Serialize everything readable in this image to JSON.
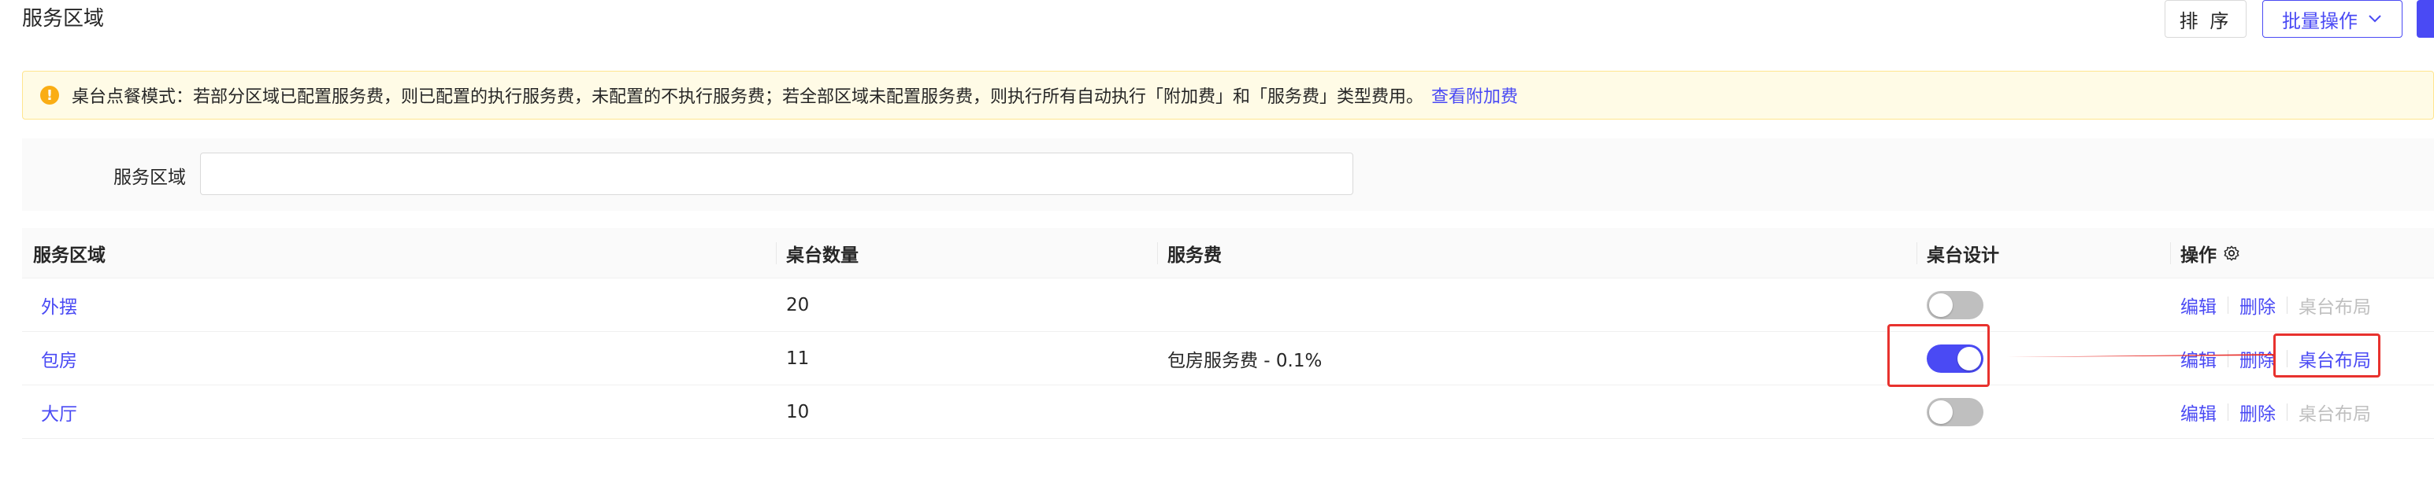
{
  "header": {
    "title": "服务区域",
    "sort_label": "排 序",
    "batch_label": "批量操作"
  },
  "notice": {
    "text": "桌台点餐模式：若部分区域已配置服务费，则已配置的执行服务费，未配置的不执行服务费；若全部区域未配置服务费，则执行所有自动执行「附加费」和「服务费」类型费用。",
    "link": "查看附加费"
  },
  "filter": {
    "label": "服务区域",
    "value": "",
    "placeholder": ""
  },
  "table": {
    "columns": [
      "服务区域",
      "桌台数量",
      "服务费",
      "桌台设计",
      "操作"
    ],
    "rows": [
      {
        "area": "外摆",
        "count": "20",
        "fee": "",
        "design_enabled": false,
        "actions": [
          "编辑",
          "删除",
          "桌台布局"
        ]
      },
      {
        "area": "包房",
        "count": "11",
        "fee": "包房服务费 - 0.1%",
        "design_enabled": true,
        "actions": [
          "编辑",
          "删除",
          "桌台布局"
        ]
      },
      {
        "area": "大厅",
        "count": "10",
        "fee": "",
        "design_enabled": false,
        "actions": [
          "编辑",
          "删除",
          "桌台布局"
        ]
      }
    ]
  },
  "colors": {
    "primary": "#4a4af4",
    "warning_bg": "#fffbe6",
    "warning_icon": "#faad14",
    "highlight": "#e8322e",
    "disabled_text": "#bfbfbf"
  }
}
